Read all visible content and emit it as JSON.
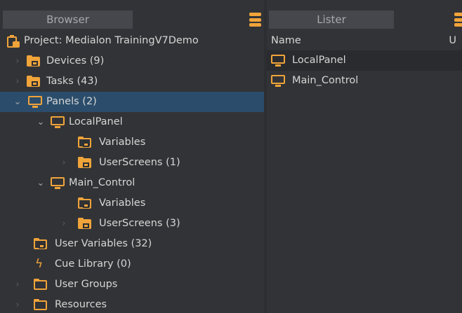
{
  "browser": {
    "title": "Browser",
    "tree": [
      {
        "label": "Project: Medialon TrainingV7Demo",
        "icon": "clipboard-icon",
        "arrow": "",
        "level": 0
      },
      {
        "label": "Devices (9)",
        "icon": "folder-icon",
        "arrow": "collapsed",
        "level": 1
      },
      {
        "label": "Tasks (43)",
        "icon": "folder-icon",
        "arrow": "collapsed",
        "level": 1
      },
      {
        "label": "Panels (2)",
        "icon": "monitor-icon",
        "arrow": "expanded",
        "level": 1,
        "selected": true
      },
      {
        "label": "LocalPanel",
        "icon": "monitor-icon",
        "arrow": "expanded",
        "level": 2
      },
      {
        "label": "Variables",
        "icon": "folder-icon",
        "arrow": "",
        "level": 3
      },
      {
        "label": "UserScreens (1)",
        "icon": "folder-icon",
        "arrow": "collapsed",
        "level": 3
      },
      {
        "label": "Main_Control",
        "icon": "monitor-icon",
        "arrow": "expanded",
        "level": 2
      },
      {
        "label": "Variables",
        "icon": "folder-icon",
        "arrow": "",
        "level": 3
      },
      {
        "label": "UserScreens (3)",
        "icon": "folder-icon",
        "arrow": "collapsed",
        "level": 3
      },
      {
        "label": "User Variables (32)",
        "icon": "folder-icon",
        "arrow": "",
        "level": 1
      },
      {
        "label": "Cue Library (0)",
        "icon": "bolt-icon",
        "arrow": "",
        "level": 1
      },
      {
        "label": "User Groups",
        "icon": "folder-icon",
        "arrow": "collapsed",
        "level": 1
      },
      {
        "label": "Resources",
        "icon": "folder-icon",
        "arrow": "collapsed",
        "level": 1
      }
    ]
  },
  "lister": {
    "title": "Lister",
    "columns": {
      "name": "Name",
      "u": "U"
    },
    "items": [
      {
        "label": "LocalPanel",
        "icon": "monitor-icon"
      },
      {
        "label": "Main_Control",
        "icon": "monitor-icon"
      }
    ]
  },
  "colors": {
    "accent": "#f0a43a",
    "selected": "#2b4d6b",
    "panel": "#323336",
    "tab": "#45474c"
  }
}
